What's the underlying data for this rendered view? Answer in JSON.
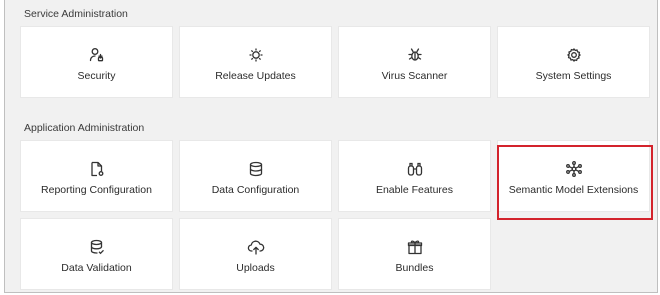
{
  "sections": {
    "service": {
      "title": "Service Administration",
      "tiles": [
        {
          "label": "Security",
          "icon": "security-icon"
        },
        {
          "label": "Release Updates",
          "icon": "release-updates-icon"
        },
        {
          "label": "Virus Scanner",
          "icon": "virus-scanner-icon"
        },
        {
          "label": "System Settings",
          "icon": "system-settings-icon"
        }
      ]
    },
    "application": {
      "title": "Application Administration",
      "tiles": [
        {
          "label": "Reporting Configuration",
          "icon": "reporting-configuration-icon"
        },
        {
          "label": "Data Configuration",
          "icon": "data-configuration-icon"
        },
        {
          "label": "Enable Features",
          "icon": "enable-features-icon"
        },
        {
          "label": "Semantic Model Extensions",
          "icon": "semantic-model-extensions-icon"
        },
        {
          "label": "Data Validation",
          "icon": "data-validation-icon"
        },
        {
          "label": "Uploads",
          "icon": "uploads-icon"
        },
        {
          "label": "Bundles",
          "icon": "bundles-icon"
        }
      ]
    }
  },
  "colors": {
    "highlight": "#d3232c",
    "panel_bg": "#f1f1f1",
    "tile_bg": "#ffffff"
  }
}
